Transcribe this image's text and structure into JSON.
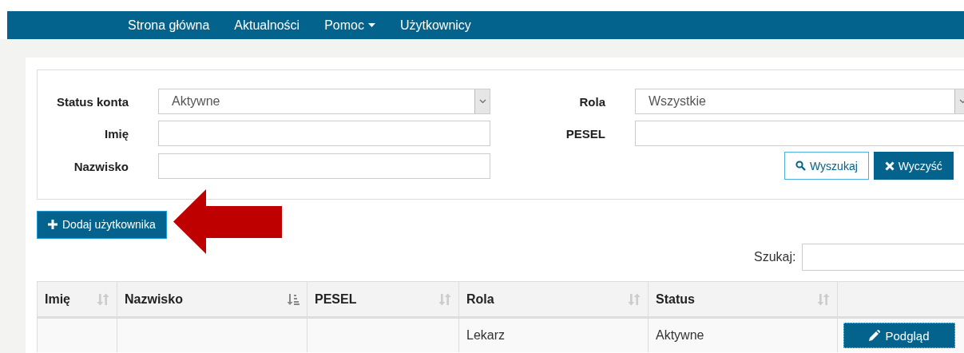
{
  "nav": [
    {
      "label": "Strona główna",
      "dropdown": false
    },
    {
      "label": "Aktualności",
      "dropdown": false
    },
    {
      "label": "Pomoc",
      "dropdown": true
    },
    {
      "label": "Użytkownicy",
      "dropdown": false
    }
  ],
  "filters": {
    "status_label": "Status konta",
    "status_value": "Aktywne",
    "first_name_label": "Imię",
    "last_name_label": "Nazwisko",
    "role_label": "Rola",
    "role_value": "Wszystkie",
    "pesel_label": "PESEL"
  },
  "filter_buttons": [
    {
      "label": "Wyszukaj",
      "kind": "search"
    },
    {
      "label": "Wyczyść",
      "kind": "clear"
    }
  ],
  "add_button": "Dodaj użytkownika",
  "search_label": "Szukaj:",
  "table": {
    "columns": [
      {
        "label": "Imię",
        "sorted": false
      },
      {
        "label": "Nazwisko",
        "sorted": true
      },
      {
        "label": "PESEL",
        "sorted": false
      },
      {
        "label": "Rola",
        "sorted": false
      },
      {
        "label": "Status",
        "sorted": false
      }
    ],
    "rows": [
      {
        "role": "Lekarz",
        "status": "Aktywne",
        "action": "Podgląd"
      }
    ]
  }
}
